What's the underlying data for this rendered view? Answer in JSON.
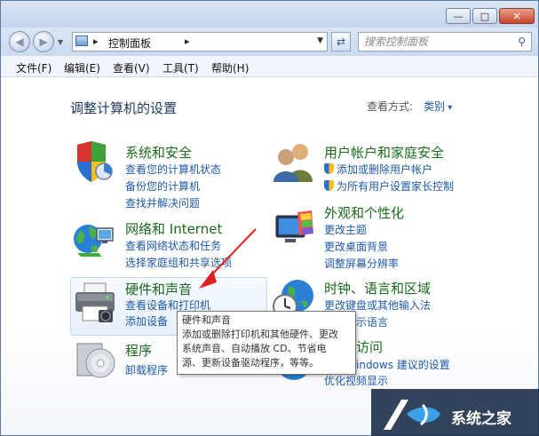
{
  "window": {
    "controls": {
      "minimize": "—",
      "maximize": "□",
      "close": "✕"
    }
  },
  "nav": {
    "back_icon": "back-arrow-icon",
    "forward_icon": "forward-arrow-icon",
    "address": "控制面板",
    "search_placeholder": "搜索控制面板"
  },
  "menu": [
    "文件(F)",
    "编辑(E)",
    "查看(V)",
    "工具(T)",
    "帮助(H)"
  ],
  "main": {
    "heading": "调整计算机的设置",
    "view_by_label": "查看方式:",
    "view_by_value": "类别"
  },
  "categories": {
    "system": {
      "title": "系统和安全",
      "links": [
        "查看您的计算机状态",
        "备份您的计算机",
        "查找并解决问题"
      ]
    },
    "network": {
      "title": "网络和 Internet",
      "links": [
        "查看网络状态和任务",
        "选择家庭组和共享选项"
      ]
    },
    "hardware": {
      "title": "硬件和声音",
      "links": [
        "查看设备和打印机",
        "添加设备"
      ]
    },
    "programs": {
      "title": "程序",
      "links": [
        "卸载程序"
      ]
    },
    "users": {
      "title": "用户帐户和家庭安全",
      "links": [
        "添加或删除用户帐户",
        "为所有用户设置家长控制"
      ]
    },
    "appearance": {
      "title": "外观和个性化",
      "links": [
        "更改主题",
        "更改桌面背景",
        "调整屏幕分辨率"
      ]
    },
    "clock": {
      "title": "时钟、语言和区域",
      "links": [
        "更改键盘或其他输入法",
        "示语言"
      ]
    },
    "ease": {
      "title": "访问",
      "links": [
        "indows 建议的设置",
        "优化视频显示"
      ]
    }
  },
  "tooltip": {
    "lines": [
      "硬件和声音",
      "添加或删除打印机和其他硬件、更改",
      "系统声音、自动播放 CD、节省电",
      "源、更新设备驱动程序，等等。"
    ]
  },
  "watermark": {
    "text": "系统之家"
  },
  "colors": {
    "link": "#1f5aa8",
    "category_title": "#1a6b1a",
    "heading": "#1e395b",
    "arrow": "#e02020"
  }
}
